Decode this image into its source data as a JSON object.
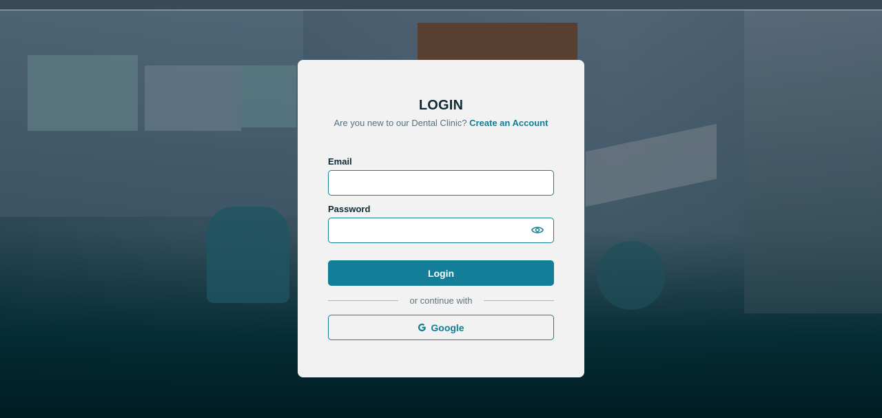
{
  "login": {
    "title": "LOGIN",
    "subtitle_text": "Are you new to our Dental Clinic?",
    "create_account_link": "Create an Account",
    "email_label": "Email",
    "email_value": "",
    "password_label": "Password",
    "password_value": "",
    "login_button": "Login",
    "divider_text": "or continue with",
    "google_button": "Google"
  },
  "icons": {
    "password_toggle": "eye-icon",
    "google": "google-g-icon"
  },
  "colors": {
    "accent": "#127e97",
    "card_bg": "#f2f2f2",
    "heading": "#0e2a36"
  }
}
